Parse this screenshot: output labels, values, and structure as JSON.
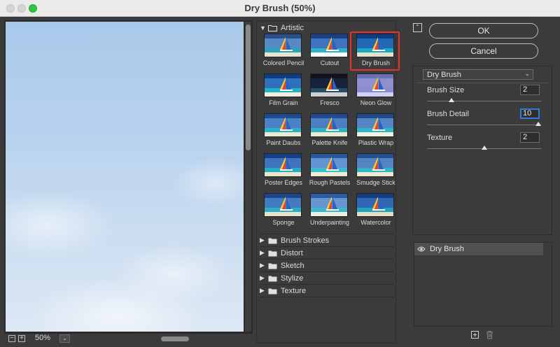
{
  "window": {
    "title": "Dry Brush (50%)"
  },
  "preview": {
    "zoom": "50%",
    "zoom_out": "−",
    "zoom_in": "+",
    "zoom_dropdown_icon": "chevron-down-icon"
  },
  "gallery": {
    "categories": [
      {
        "label": "Artistic",
        "expanded": true,
        "filters": [
          "Colored Pencil",
          "Cutout",
          "Dry Brush",
          "Film Grain",
          "Fresco",
          "Neon Glow",
          "Paint Daubs",
          "Palette Knife",
          "Plastic Wrap",
          "Poster Edges",
          "Rough Pastels",
          "Smudge Stick",
          "Sponge",
          "Underpainting",
          "Watercolor"
        ],
        "selected": "Dry Brush"
      },
      {
        "label": "Brush Strokes",
        "expanded": false
      },
      {
        "label": "Distort",
        "expanded": false
      },
      {
        "label": "Sketch",
        "expanded": false
      },
      {
        "label": "Stylize",
        "expanded": false
      },
      {
        "label": "Texture",
        "expanded": false
      }
    ]
  },
  "actions": {
    "ok": "OK",
    "cancel": "Cancel"
  },
  "settings": {
    "filter": "Dry Brush",
    "params": [
      {
        "label": "Brush Size",
        "value": "2",
        "level": 0.2
      },
      {
        "label": "Brush Detail",
        "value": "10",
        "level": 1.0,
        "focused": true
      },
      {
        "label": "Texture",
        "value": "2",
        "level": 0.5
      }
    ]
  },
  "layers": {
    "items": [
      {
        "label": "Dry Brush",
        "visible": true
      }
    ]
  },
  "colors": {
    "selection": "#e8322a",
    "focus": "#2f7ae0",
    "panel": "#3b3b3b"
  }
}
